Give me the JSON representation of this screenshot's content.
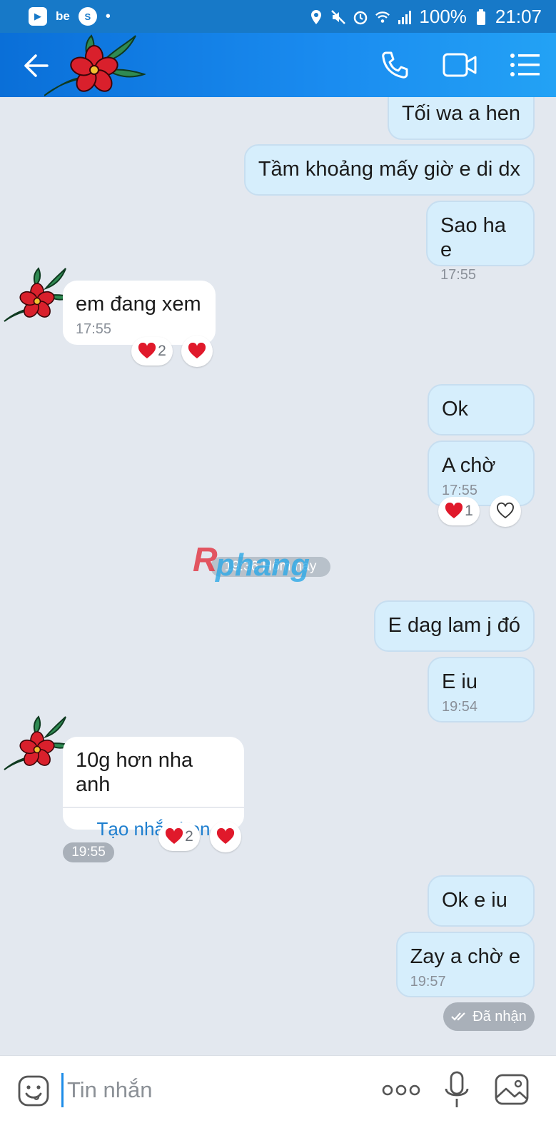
{
  "status_bar": {
    "apps": [
      "play-icon",
      "be",
      "shazam-icon",
      "•"
    ],
    "battery": "100%",
    "time": "21:07"
  },
  "header": {
    "back_icon": "back-arrow-icon",
    "call_icon": "phone-icon",
    "video_icon": "video-camera-icon",
    "menu_icon": "list-menu-icon"
  },
  "messages": [
    {
      "id": "m1",
      "dir": "out",
      "text": "Tối wa a hen"
    },
    {
      "id": "m2",
      "dir": "out",
      "text": "Tầm khoảng mấy giờ e di dx"
    },
    {
      "id": "m3",
      "dir": "out",
      "text": "Sao ha e",
      "time": "17:55"
    },
    {
      "id": "m4",
      "dir": "in",
      "text": "em đang xem",
      "time": "17:55",
      "reaction_count": "2"
    },
    {
      "id": "m5",
      "dir": "out",
      "text": "Ok"
    },
    {
      "id": "m6",
      "dir": "out",
      "text": "A chờ",
      "time": "17:55",
      "reaction_count": "1"
    },
    {
      "id": "m7",
      "dir": "out",
      "text": "E dag lam j đó"
    },
    {
      "id": "m8",
      "dir": "out",
      "text": "E iu",
      "time": "19:54"
    },
    {
      "id": "m9",
      "dir": "in",
      "text": "10g hơn nha anh",
      "action": "Tạo nhắc hẹn",
      "reaction_count": "2",
      "time": "19:55"
    },
    {
      "id": "m10",
      "dir": "out",
      "text": "Ok e iu"
    },
    {
      "id": "m11",
      "dir": "out",
      "text": "Zay a chờ e",
      "time": "19:57"
    }
  ],
  "date_separator": "19:36 Hôm nay",
  "watermark": "Rphang",
  "delivery_status": "Đã nhận",
  "composer": {
    "placeholder": "Tin nhắn",
    "icons": [
      "emoji-icon",
      "more-icon",
      "microphone-icon",
      "photo-icon"
    ]
  },
  "colors": {
    "header": "#1a8cf0",
    "outgoing_bubble": "#d6eefc",
    "incoming_bubble": "#ffffff",
    "background": "#e3e8ef",
    "heart": "#e0192b",
    "link": "#1f7fcf"
  }
}
